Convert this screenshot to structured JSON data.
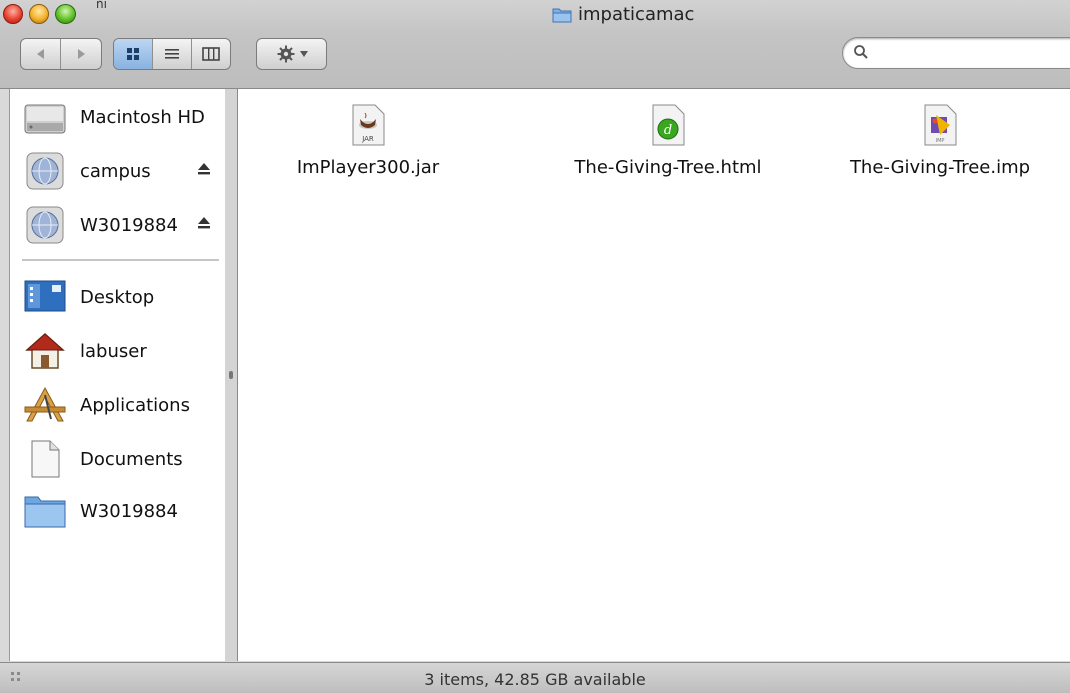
{
  "window": {
    "title": "impaticamac",
    "corner_glyph": "ňı"
  },
  "toolbar": {
    "back_icon": "back-arrow-icon",
    "forward_icon": "forward-arrow-icon",
    "views": [
      "icon-view",
      "list-view",
      "column-view"
    ],
    "active_view": "icon-view",
    "action_icon": "gear-icon",
    "search": {
      "value": "",
      "placeholder": ""
    }
  },
  "sidebar": {
    "devices": [
      {
        "label": "Macintosh HD",
        "icon": "hard-drive-icon",
        "eject": false
      },
      {
        "label": "campus",
        "icon": "network-volume-icon",
        "eject": true
      },
      {
        "label": "W3019884",
        "icon": "network-volume-icon",
        "eject": true
      }
    ],
    "places": [
      {
        "label": "Desktop",
        "icon": "desktop-icon"
      },
      {
        "label": "labuser",
        "icon": "home-icon"
      },
      {
        "label": "Applications",
        "icon": "applications-icon"
      },
      {
        "label": "Documents",
        "icon": "documents-icon"
      },
      {
        "label": "W3019884",
        "icon": "folder-icon"
      }
    ]
  },
  "files": [
    {
      "name": "ImPlayer300.jar",
      "icon": "jar-file-icon",
      "badge": "JAR"
    },
    {
      "name": "The-Giving-Tree.html",
      "icon": "html-file-icon"
    },
    {
      "name": "The-Giving-Tree.imp",
      "icon": "imp-file-icon",
      "badge": "IMP"
    }
  ],
  "status": {
    "text": "3 items, 42.85 GB available"
  },
  "colors": {
    "selected_view": "#88b2e0",
    "folder_blue": "#6ea6e0"
  }
}
